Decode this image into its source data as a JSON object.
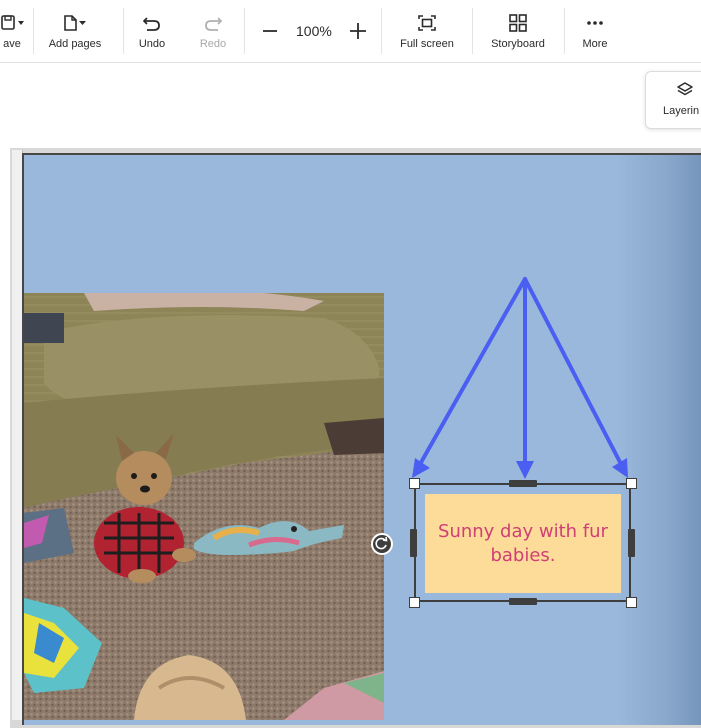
{
  "toolbar": {
    "save_label": "ave",
    "add_pages_label": "Add pages",
    "undo_label": "Undo",
    "redo_label": "Redo",
    "zoom_value": "100%",
    "full_screen_label": "Full screen",
    "storyboard_label": "Storyboard",
    "more_label": "More"
  },
  "layering": {
    "label": "Layerin"
  },
  "textbox": {
    "line1": "Sunny day with fur",
    "line2": "babies."
  },
  "colors": {
    "page_background": "#9ab8db",
    "textbox_fill": "#fddc9a",
    "textbox_text": "#cf3f74",
    "arrow": "#4a5ef2",
    "selection": "#3e3e3e"
  },
  "icons": [
    "save-icon",
    "add-page-icon",
    "undo-icon",
    "redo-icon",
    "zoom-out-icon",
    "zoom-in-icon",
    "full-screen-icon",
    "storyboard-icon",
    "more-icon",
    "layering-icon",
    "rotate-icon"
  ]
}
